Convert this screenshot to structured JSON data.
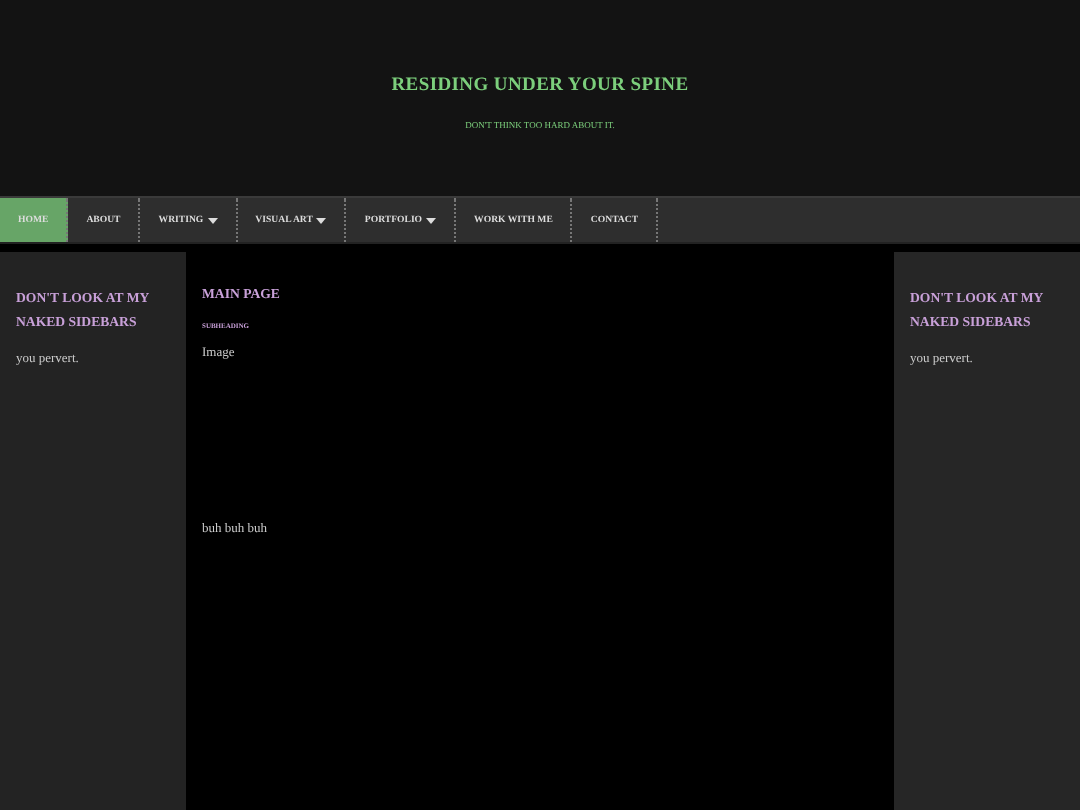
{
  "header": {
    "title": "RESIDING UNDER YOUR SPINE",
    "tagline": "DON'T THINK TOO HARD ABOUT IT."
  },
  "nav": [
    {
      "label": "HOME",
      "selected": true,
      "dropdown": false
    },
    {
      "label": "ABOUT",
      "selected": false,
      "dropdown": false
    },
    {
      "label": "WRITING",
      "selected": false,
      "dropdown": true
    },
    {
      "label": "VISUAL ART",
      "selected": false,
      "dropdown": true
    },
    {
      "label": "PORTFOLIO",
      "selected": false,
      "dropdown": true
    },
    {
      "label": "WORK WITH ME",
      "selected": false,
      "dropdown": false
    },
    {
      "label": "CONTACT",
      "selected": false,
      "dropdown": false
    }
  ],
  "left_sidebar": {
    "heading": "DON'T LOOK AT MY NAKED SIDEBARS",
    "text": "you pervert."
  },
  "main": {
    "heading": "MAIN PAGE",
    "subheading": "SUBHEADING",
    "image_text": "Image",
    "body": "buh buh buh"
  },
  "right_sidebar": {
    "heading": "DON'T LOOK AT MY NAKED SIDEBARS",
    "text": "you pervert."
  }
}
